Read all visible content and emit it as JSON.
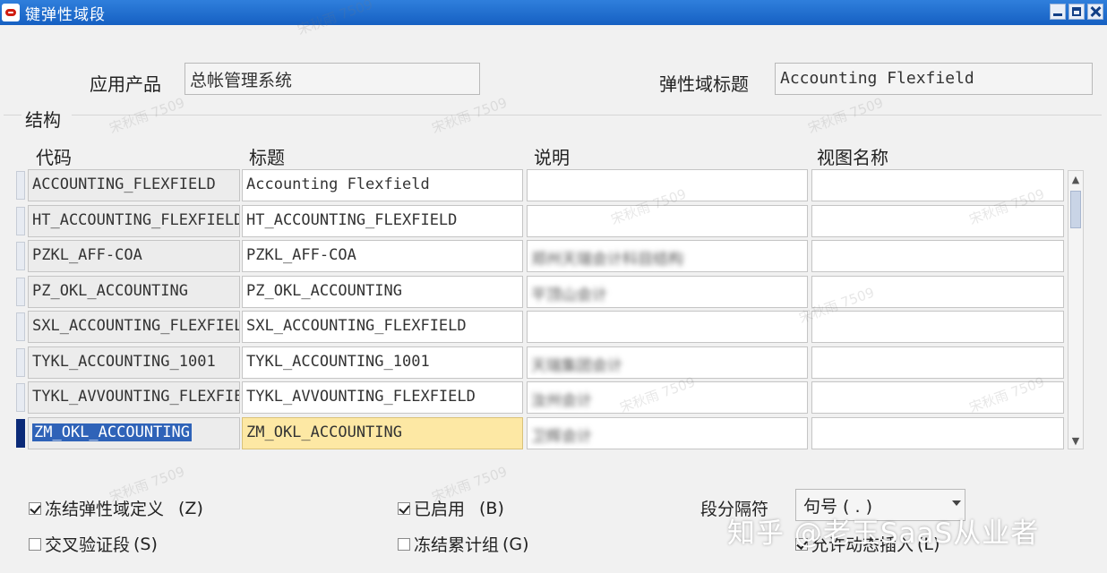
{
  "window": {
    "title": "键弹性域段"
  },
  "header": {
    "app_product_label": "应用产品",
    "app_product_value": "总帐管理系统",
    "flex_title_label": "弹性域标题",
    "flex_title_value": "Accounting Flexfield"
  },
  "structure": {
    "section_label": "结构",
    "columns": {
      "code": "代码",
      "title": "标题",
      "desc": "说明",
      "view": "视图名称"
    },
    "rows": [
      {
        "code": "ACCOUNTING_FLEXFIELD",
        "title": "Accounting Flexfield",
        "desc": "",
        "view": ""
      },
      {
        "code": "HT_ACCOUNTING_FLEXFIELD",
        "title": "HT_ACCOUNTING_FLEXFIELD",
        "desc": "",
        "view": ""
      },
      {
        "code": "PZKL_AFF-COA",
        "title": "PZKL_AFF-COA",
        "desc": "郑州天瑞会计科目结构",
        "view": ""
      },
      {
        "code": "PZ_OKL_ACCOUNTING",
        "title": "PZ_OKL_ACCOUNTING",
        "desc": "平顶山会计",
        "view": ""
      },
      {
        "code": "SXL_ACCOUNTING_FLEXFIELD",
        "title": "SXL_ACCOUNTING_FLEXFIELD",
        "desc": "",
        "view": ""
      },
      {
        "code": "TYKL_ACCOUNTING_1001",
        "title": "TYKL_ACCOUNTING_1001",
        "desc": "天瑞集团会计",
        "view": ""
      },
      {
        "code": "TYKL_AVVOUNTING_FLEXFIELD",
        "title": "TYKL_AVVOUNTING_FLEXFIELD",
        "desc": "汝州会计",
        "view": ""
      },
      {
        "code": "ZM_OKL_ACCOUNTING",
        "title": "ZM_OKL_ACCOUNTING",
        "desc": "卫辉会计",
        "view": ""
      }
    ]
  },
  "options": {
    "freeze_def": "冻结弹性域定义",
    "freeze_def_key": "(Z)",
    "enabled": "已启用",
    "enabled_key": "(B)",
    "cross_validate": "交叉验证段",
    "cross_validate_key": "(S)",
    "freeze_rollup": "冻结累计组",
    "freeze_rollup_key": "(G)",
    "separator_label": "段分隔符",
    "separator_value": "句号 ( . )",
    "dynamic_insert": "允许动态插入",
    "dynamic_insert_key": "(L)"
  },
  "watermark": {
    "main": "知乎 @老玉SaaS从业者",
    "repeat": "宋秋雨 7509"
  }
}
